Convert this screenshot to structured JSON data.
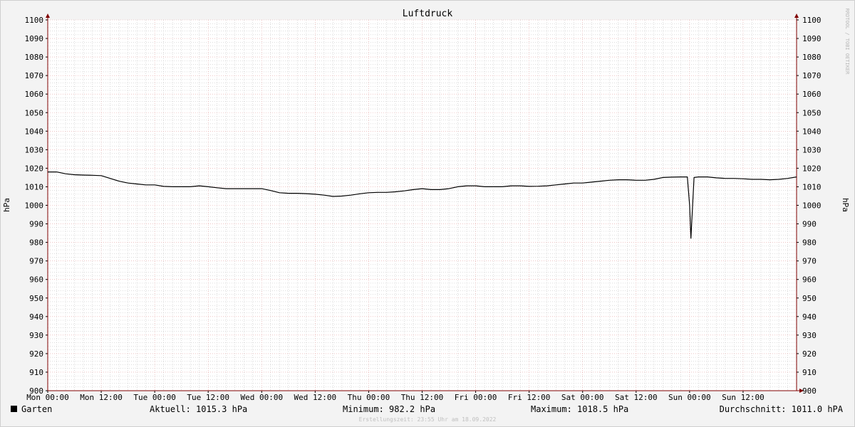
{
  "chart_data": {
    "type": "line",
    "title": "Luftdruck",
    "ylabel": "hPa",
    "ylabel_right": "hPa",
    "ylim": [
      900,
      1100
    ],
    "y_ticks": [
      900,
      910,
      920,
      930,
      940,
      950,
      960,
      970,
      980,
      990,
      1000,
      1010,
      1020,
      1030,
      1040,
      1050,
      1060,
      1070,
      1080,
      1090,
      1100
    ],
    "x_tick_labels": [
      "Mon 00:00",
      "Mon 12:00",
      "Tue 00:00",
      "Tue 12:00",
      "Wed 00:00",
      "Wed 12:00",
      "Thu 00:00",
      "Thu 12:00",
      "Fri 00:00",
      "Fri 12:00",
      "Sat 00:00",
      "Sat 12:00",
      "Sun 00:00",
      "Sun 12:00"
    ],
    "x_unit": "hours",
    "x_range": [
      0,
      168
    ],
    "grid": true,
    "watermark": "RRDTOOL / TOBI OETIKER",
    "series": [
      {
        "name": "Garten",
        "color": "#000000",
        "x": [
          0,
          2,
          4,
          6,
          8,
          10,
          12,
          14,
          16,
          18,
          20,
          22,
          24,
          26,
          28,
          30,
          32,
          34,
          36,
          38,
          40,
          42,
          44,
          46,
          48,
          50,
          52,
          54,
          56,
          58,
          60,
          62,
          64,
          66,
          68,
          70,
          72,
          74,
          76,
          78,
          80,
          82,
          84,
          86,
          88,
          90,
          92,
          94,
          96,
          98,
          100,
          102,
          104,
          106,
          108,
          110,
          112,
          114,
          116,
          118,
          120,
          122,
          124,
          126,
          128,
          130,
          132,
          134,
          136,
          138,
          140,
          142,
          143.5,
          144,
          144.3,
          145,
          146,
          148,
          150,
          152,
          154,
          156,
          158,
          160,
          162,
          164,
          166,
          168
        ],
        "values": [
          1018,
          1018,
          1017,
          1016.5,
          1016.3,
          1016.2,
          1016,
          1014.5,
          1013,
          1012,
          1011.5,
          1011,
          1011,
          1010.2,
          1010,
          1010,
          1010,
          1010.5,
          1010,
          1009.5,
          1009,
          1009,
          1009,
          1009,
          1009,
          1008,
          1006.8,
          1006.5,
          1006.5,
          1006.3,
          1006,
          1005.5,
          1004.8,
          1005,
          1005.5,
          1006.2,
          1006.8,
          1007,
          1007,
          1007.3,
          1007.8,
          1008.5,
          1009,
          1008.5,
          1008.5,
          1009,
          1010,
          1010.5,
          1010.5,
          1010,
          1010,
          1010,
          1010.5,
          1010.5,
          1010.2,
          1010.3,
          1010.5,
          1011,
          1011.5,
          1012,
          1012,
          1012.5,
          1013,
          1013.5,
          1013.8,
          1013.8,
          1013.5,
          1013.5,
          1014,
          1015,
          1015.2,
          1015.3,
          1015.3,
          1000,
          982.2,
          1015,
          1015.3,
          1015.3,
          1014.8,
          1014.5,
          1014.5,
          1014.3,
          1014,
          1014,
          1013.8,
          1014,
          1014.5,
          1015.3
        ]
      }
    ]
  },
  "legend": {
    "series_name": "Garten",
    "series_color": "#000000",
    "current": "Aktuell: 1015.3 hPa",
    "minimum": "Minimum: 982.2 hPa",
    "maximum": "Maximum: 1018.5 hPa",
    "average": "Durchschnitt: 1011.0 hPA"
  },
  "footer": {
    "created": "Erstellungszeit: 23:55 Uhr am 18.09.2022"
  },
  "colors": {
    "background": "#f3f3f3",
    "plot_background": "#ffffff",
    "grid_minor": "#bbbbbb",
    "grid_major": "#e4a0a0",
    "axis": "#800000",
    "text": "#000000"
  }
}
